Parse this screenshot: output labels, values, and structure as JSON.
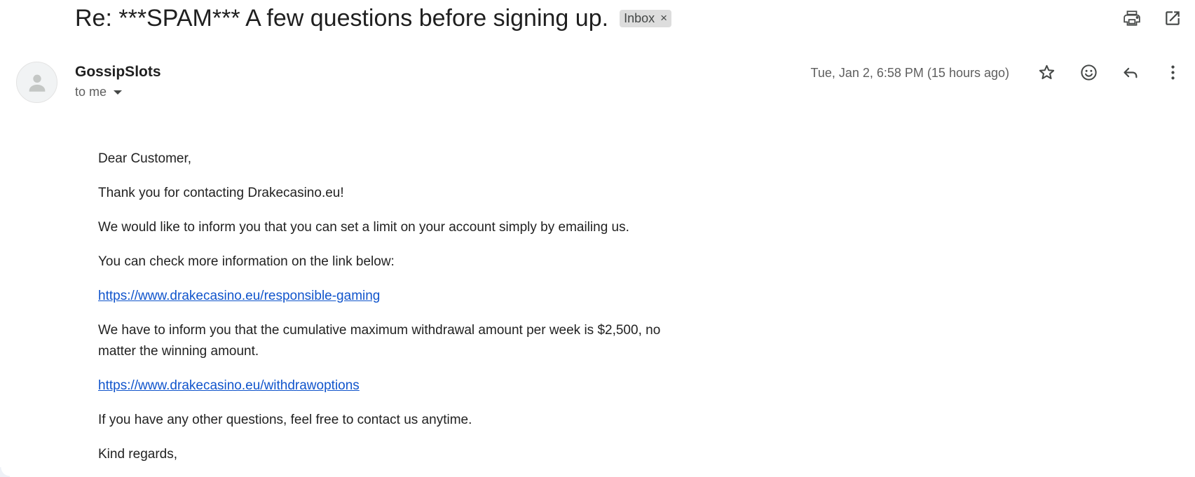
{
  "subject": "Re: ***SPAM*** A few questions before signing up.",
  "label": {
    "name": "Inbox",
    "remove_symbol": "×"
  },
  "sender": {
    "name": "GossipSlots",
    "recipient": "to me"
  },
  "date": "Tue, Jan 2, 6:58 PM (15 hours ago)",
  "toolbar_icons": [
    "print-icon",
    "open-in-new-window-icon"
  ],
  "message_icons": [
    "star-icon",
    "emoji-reaction-icon",
    "reply-icon",
    "more-options-icon"
  ],
  "body": {
    "greeting": "Dear Customer,",
    "thanks": "Thank you for contacting Drakecasino.eu!",
    "limit_info": "We would like to inform you that you can set a limit on your account simply by emailing us.",
    "check_info": "You can check more information on the link below:",
    "link_responsible": "https://www.drakecasino.eu/responsible-gaming",
    "withdrawal_info": "We have to inform you that the cumulative maximum withdrawal amount per week is $2,500, no matter the winning amount.",
    "link_withdraw": "https://www.drakecasino.eu/withdrawoptions",
    "questions": "If you have any other questions, feel free to contact us anytime.",
    "closing": "Kind regards,"
  },
  "colors": {
    "link": "#1155cc",
    "label_chip_bg": "#dddddd",
    "text_primary": "#1f1f1f",
    "text_secondary": "#5e5e5e"
  }
}
